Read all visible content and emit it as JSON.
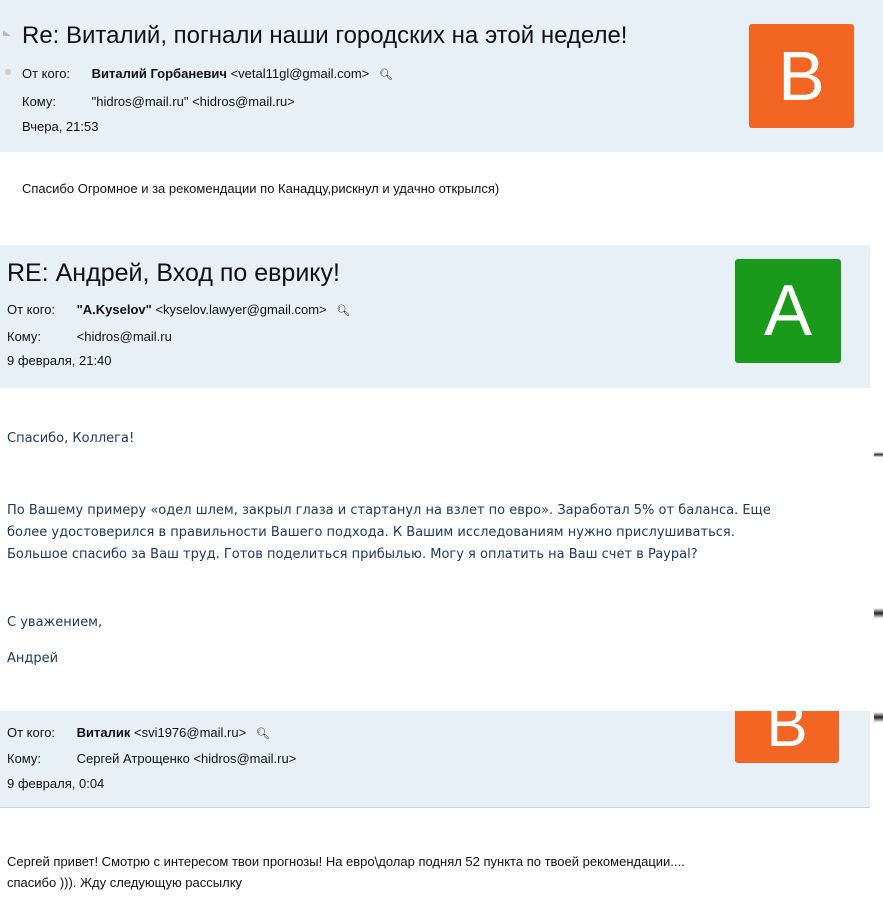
{
  "colors": {
    "header_bg": "#e8f0f7",
    "avatar_orange": "#f26522",
    "avatar_green": "#1a9a1a",
    "body_blue": "#1f3864"
  },
  "mail1": {
    "subject": "Re: Виталий, погнали наши городских на этой неделе!",
    "from_label": "От кого:",
    "from_name": "Виталий Горбаневич",
    "from_email": "<vetal11gl@gmail.com>",
    "to_label": "Кому:",
    "to_value": "\"hidros@mail.ru\" <hidros@mail.ru>",
    "date": "Вчера, 21:53",
    "avatar_letter": "В",
    "body": "Спасибо Огромное и за рекомендации по Канадцу,рискнул и удачно открылся)"
  },
  "mail2": {
    "subject": "RE: Андрей, Вход по еврику!",
    "from_label": "От кого:",
    "from_name": "\"A.Kyselov\"",
    "from_email": "<kyselov.lawyer@gmail.com>",
    "to_label": "Кому:",
    "to_value": "<hidros@mail.ru",
    "date": "9 февраля, 21:40",
    "avatar_letter": "А",
    "body_greeting": "Спасибо, Коллега!",
    "body_line1": "По Вашему примеру «одел шлем, закрыл глаза и стартанул на взлет по евро». Заработал 5% от баланса. Еще",
    "body_line2": "более удостоверился в правильности  Вашего подхода. К Вашим исследованиям нужно прислушиваться.",
    "body_line3": "Большое спасибо за Ваш труд. Готов поделиться прибылью. Могу я оплатить на Ваш счет в Paypal?",
    "signoff": "С уважением,",
    "signature": "Андрей"
  },
  "mail3": {
    "from_label": "От кого:",
    "from_name": "Виталик",
    "from_email": "<svi1976@mail.ru>",
    "to_label": "Кому:",
    "to_value": "Сергей Атрощенко <hidros@mail.ru>",
    "date": "9 февраля, 0:04",
    "avatar_letter": "В",
    "body_line1": "Сергей привет! Смотрю с интересом твои прогнозы! На евро\\долар поднял 52 пункта по твоей рекомендации....",
    "body_line2": "спасибо ))). Жду следующую рассылку"
  }
}
